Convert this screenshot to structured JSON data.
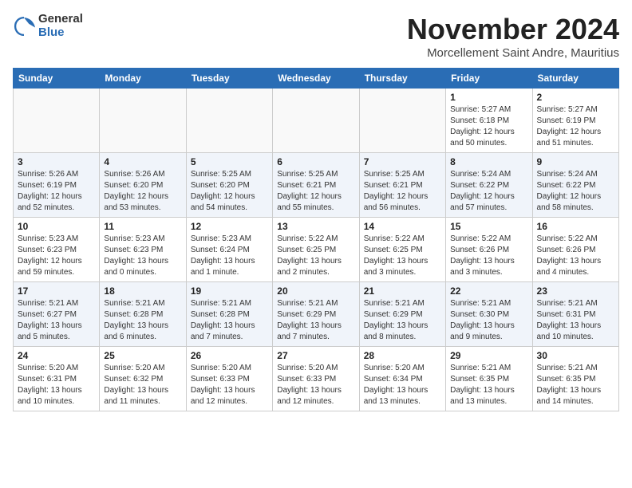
{
  "logo": {
    "general": "General",
    "blue": "Blue"
  },
  "title": "November 2024",
  "location": "Morcellement Saint Andre, Mauritius",
  "weekdays": [
    "Sunday",
    "Monday",
    "Tuesday",
    "Wednesday",
    "Thursday",
    "Friday",
    "Saturday"
  ],
  "weeks": [
    [
      {
        "day": "",
        "detail": ""
      },
      {
        "day": "",
        "detail": ""
      },
      {
        "day": "",
        "detail": ""
      },
      {
        "day": "",
        "detail": ""
      },
      {
        "day": "",
        "detail": ""
      },
      {
        "day": "1",
        "detail": "Sunrise: 5:27 AM\nSunset: 6:18 PM\nDaylight: 12 hours and 50 minutes."
      },
      {
        "day": "2",
        "detail": "Sunrise: 5:27 AM\nSunset: 6:19 PM\nDaylight: 12 hours and 51 minutes."
      }
    ],
    [
      {
        "day": "3",
        "detail": "Sunrise: 5:26 AM\nSunset: 6:19 PM\nDaylight: 12 hours and 52 minutes."
      },
      {
        "day": "4",
        "detail": "Sunrise: 5:26 AM\nSunset: 6:20 PM\nDaylight: 12 hours and 53 minutes."
      },
      {
        "day": "5",
        "detail": "Sunrise: 5:25 AM\nSunset: 6:20 PM\nDaylight: 12 hours and 54 minutes."
      },
      {
        "day": "6",
        "detail": "Sunrise: 5:25 AM\nSunset: 6:21 PM\nDaylight: 12 hours and 55 minutes."
      },
      {
        "day": "7",
        "detail": "Sunrise: 5:25 AM\nSunset: 6:21 PM\nDaylight: 12 hours and 56 minutes."
      },
      {
        "day": "8",
        "detail": "Sunrise: 5:24 AM\nSunset: 6:22 PM\nDaylight: 12 hours and 57 minutes."
      },
      {
        "day": "9",
        "detail": "Sunrise: 5:24 AM\nSunset: 6:22 PM\nDaylight: 12 hours and 58 minutes."
      }
    ],
    [
      {
        "day": "10",
        "detail": "Sunrise: 5:23 AM\nSunset: 6:23 PM\nDaylight: 12 hours and 59 minutes."
      },
      {
        "day": "11",
        "detail": "Sunrise: 5:23 AM\nSunset: 6:23 PM\nDaylight: 13 hours and 0 minutes."
      },
      {
        "day": "12",
        "detail": "Sunrise: 5:23 AM\nSunset: 6:24 PM\nDaylight: 13 hours and 1 minute."
      },
      {
        "day": "13",
        "detail": "Sunrise: 5:22 AM\nSunset: 6:25 PM\nDaylight: 13 hours and 2 minutes."
      },
      {
        "day": "14",
        "detail": "Sunrise: 5:22 AM\nSunset: 6:25 PM\nDaylight: 13 hours and 3 minutes."
      },
      {
        "day": "15",
        "detail": "Sunrise: 5:22 AM\nSunset: 6:26 PM\nDaylight: 13 hours and 3 minutes."
      },
      {
        "day": "16",
        "detail": "Sunrise: 5:22 AM\nSunset: 6:26 PM\nDaylight: 13 hours and 4 minutes."
      }
    ],
    [
      {
        "day": "17",
        "detail": "Sunrise: 5:21 AM\nSunset: 6:27 PM\nDaylight: 13 hours and 5 minutes."
      },
      {
        "day": "18",
        "detail": "Sunrise: 5:21 AM\nSunset: 6:28 PM\nDaylight: 13 hours and 6 minutes."
      },
      {
        "day": "19",
        "detail": "Sunrise: 5:21 AM\nSunset: 6:28 PM\nDaylight: 13 hours and 7 minutes."
      },
      {
        "day": "20",
        "detail": "Sunrise: 5:21 AM\nSunset: 6:29 PM\nDaylight: 13 hours and 7 minutes."
      },
      {
        "day": "21",
        "detail": "Sunrise: 5:21 AM\nSunset: 6:29 PM\nDaylight: 13 hours and 8 minutes."
      },
      {
        "day": "22",
        "detail": "Sunrise: 5:21 AM\nSunset: 6:30 PM\nDaylight: 13 hours and 9 minutes."
      },
      {
        "day": "23",
        "detail": "Sunrise: 5:21 AM\nSunset: 6:31 PM\nDaylight: 13 hours and 10 minutes."
      }
    ],
    [
      {
        "day": "24",
        "detail": "Sunrise: 5:20 AM\nSunset: 6:31 PM\nDaylight: 13 hours and 10 minutes."
      },
      {
        "day": "25",
        "detail": "Sunrise: 5:20 AM\nSunset: 6:32 PM\nDaylight: 13 hours and 11 minutes."
      },
      {
        "day": "26",
        "detail": "Sunrise: 5:20 AM\nSunset: 6:33 PM\nDaylight: 13 hours and 12 minutes."
      },
      {
        "day": "27",
        "detail": "Sunrise: 5:20 AM\nSunset: 6:33 PM\nDaylight: 13 hours and 12 minutes."
      },
      {
        "day": "28",
        "detail": "Sunrise: 5:20 AM\nSunset: 6:34 PM\nDaylight: 13 hours and 13 minutes."
      },
      {
        "day": "29",
        "detail": "Sunrise: 5:21 AM\nSunset: 6:35 PM\nDaylight: 13 hours and 13 minutes."
      },
      {
        "day": "30",
        "detail": "Sunrise: 5:21 AM\nSunset: 6:35 PM\nDaylight: 13 hours and 14 minutes."
      }
    ]
  ]
}
